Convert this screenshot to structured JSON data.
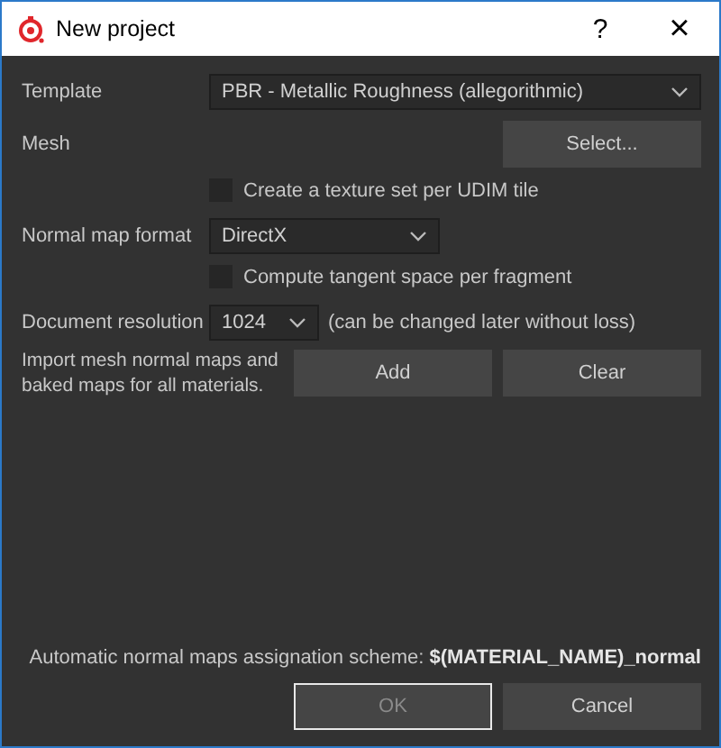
{
  "window": {
    "title": "New project",
    "help": "?",
    "close": "×"
  },
  "template": {
    "label": "Template",
    "value": "PBR - Metallic Roughness (allegorithmic)"
  },
  "mesh": {
    "label": "Mesh",
    "button": "Select..."
  },
  "udim": {
    "label": "Create a texture set per UDIM tile",
    "checked": false
  },
  "normal_format": {
    "label": "Normal map format",
    "value": "DirectX"
  },
  "tangent": {
    "label": "Compute tangent space per fragment",
    "checked": false
  },
  "resolution": {
    "label": "Document resolution",
    "value": "1024",
    "note": "(can be changed later without loss)"
  },
  "import": {
    "label": "Import mesh normal maps and baked maps for all materials.",
    "buttons": [
      "Add",
      "Clear"
    ]
  },
  "scheme": "Automatic normal maps assignation scheme: **$(MATERIAL_NAME)_normal**",
  "buttons": [
    {
      "label": "OK",
      "disabled": true,
      "focused": true
    },
    {
      "label": "Cancel",
      "disabled": false,
      "focused": false
    }
  ]
}
